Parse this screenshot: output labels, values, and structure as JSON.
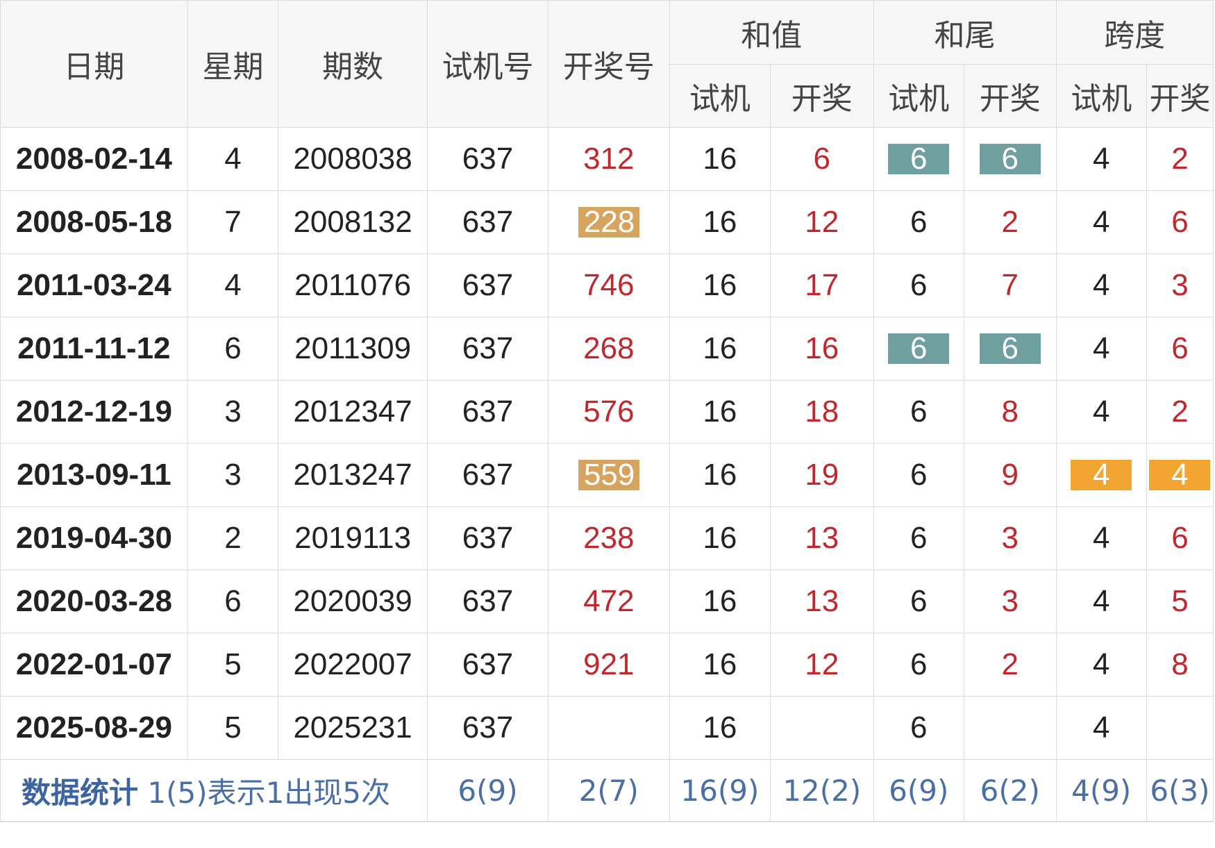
{
  "headers": {
    "date": "日期",
    "weekday": "星期",
    "issue": "期数",
    "trial_number": "试机号",
    "draw_number": "开奖号",
    "sum": "和值",
    "sum_tail": "和尾",
    "span": "跨度",
    "sub_trial": "试机",
    "sub_draw": "开奖"
  },
  "rows": [
    {
      "date": "2008-02-14",
      "weekday": "4",
      "issue": "2008038",
      "trial": "637",
      "draw": "312",
      "sum_trial": "16",
      "sum_draw": "6",
      "tail_trial": "6",
      "tail_draw": "6",
      "span_trial": "4",
      "span_draw": "2"
    },
    {
      "date": "2008-05-18",
      "weekday": "7",
      "issue": "2008132",
      "trial": "637",
      "draw": "228",
      "sum_trial": "16",
      "sum_draw": "12",
      "tail_trial": "6",
      "tail_draw": "2",
      "span_trial": "4",
      "span_draw": "6"
    },
    {
      "date": "2011-03-24",
      "weekday": "4",
      "issue": "2011076",
      "trial": "637",
      "draw": "746",
      "sum_trial": "16",
      "sum_draw": "17",
      "tail_trial": "6",
      "tail_draw": "7",
      "span_trial": "4",
      "span_draw": "3"
    },
    {
      "date": "2011-11-12",
      "weekday": "6",
      "issue": "2011309",
      "trial": "637",
      "draw": "268",
      "sum_trial": "16",
      "sum_draw": "16",
      "tail_trial": "6",
      "tail_draw": "6",
      "span_trial": "4",
      "span_draw": "6"
    },
    {
      "date": "2012-12-19",
      "weekday": "3",
      "issue": "2012347",
      "trial": "637",
      "draw": "576",
      "sum_trial": "16",
      "sum_draw": "18",
      "tail_trial": "6",
      "tail_draw": "8",
      "span_trial": "4",
      "span_draw": "2"
    },
    {
      "date": "2013-09-11",
      "weekday": "3",
      "issue": "2013247",
      "trial": "637",
      "draw": "559",
      "sum_trial": "16",
      "sum_draw": "19",
      "tail_trial": "6",
      "tail_draw": "9",
      "span_trial": "4",
      "span_draw": "4"
    },
    {
      "date": "2019-04-30",
      "weekday": "2",
      "issue": "2019113",
      "trial": "637",
      "draw": "238",
      "sum_trial": "16",
      "sum_draw": "13",
      "tail_trial": "6",
      "tail_draw": "3",
      "span_trial": "4",
      "span_draw": "6"
    },
    {
      "date": "2020-03-28",
      "weekday": "6",
      "issue": "2020039",
      "trial": "637",
      "draw": "472",
      "sum_trial": "16",
      "sum_draw": "13",
      "tail_trial": "6",
      "tail_draw": "3",
      "span_trial": "4",
      "span_draw": "5"
    },
    {
      "date": "2022-01-07",
      "weekday": "5",
      "issue": "2022007",
      "trial": "637",
      "draw": "921",
      "sum_trial": "16",
      "sum_draw": "12",
      "tail_trial": "6",
      "tail_draw": "2",
      "span_trial": "4",
      "span_draw": "8"
    },
    {
      "date": "2025-08-29",
      "weekday": "5",
      "issue": "2025231",
      "trial": "637",
      "draw": "",
      "sum_trial": "16",
      "sum_draw": "",
      "tail_trial": "6",
      "tail_draw": "",
      "span_trial": "4",
      "span_draw": ""
    }
  ],
  "stats": {
    "label": "数据统计",
    "note": "1(5)表示1出现5次",
    "trial_number": "6(9)",
    "draw_number": "2(7)",
    "sum_trial": "16(9)",
    "sum_draw": "12(2)",
    "tail_trial": "6(9)",
    "tail_draw": "6(2)",
    "span_trial": "4(9)",
    "span_draw": "6(3)"
  },
  "colors": {
    "red_text": "#c0282d",
    "teal_badge": "#6f9f9f",
    "tan_badge": "#d7a460",
    "orange_badge": "#f2a531",
    "stats_text": "#4a6fa5",
    "header_bg": "#f6f6f6",
    "border": "#dcdcdc"
  }
}
